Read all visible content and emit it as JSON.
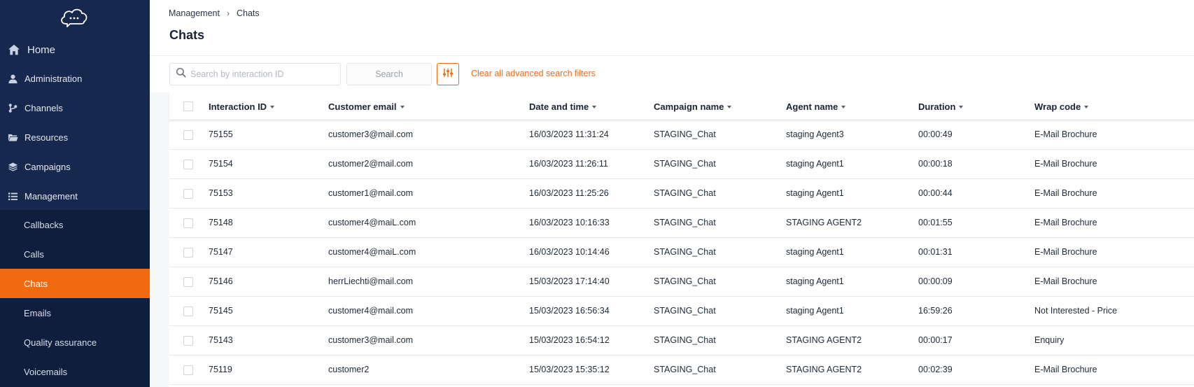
{
  "sidebar": {
    "home": "Home",
    "items": [
      {
        "label": "Administration",
        "icon": "user-icon"
      },
      {
        "label": "Channels",
        "icon": "channels-icon"
      },
      {
        "label": "Resources",
        "icon": "folder-icon"
      },
      {
        "label": "Campaigns",
        "icon": "layers-icon"
      },
      {
        "label": "Management",
        "icon": "list-icon"
      }
    ],
    "submenu": [
      {
        "label": "Callbacks",
        "active": false
      },
      {
        "label": "Calls",
        "active": false
      },
      {
        "label": "Chats",
        "active": true
      },
      {
        "label": "Emails",
        "active": false
      },
      {
        "label": "Quality assurance",
        "active": false
      },
      {
        "label": "Voicemails",
        "active": false
      }
    ]
  },
  "header": {
    "breadcrumb": [
      "Management",
      "Chats"
    ],
    "title": "Chats"
  },
  "toolbar": {
    "search_placeholder": "Search by interaction ID",
    "search_value": "",
    "search_button": "Search",
    "clear_filters": "Clear all advanced search filters"
  },
  "table": {
    "columns": [
      "Interaction ID",
      "Customer email",
      "Date and time",
      "Campaign name",
      "Agent name",
      "Duration",
      "Wrap code"
    ],
    "rows": [
      [
        "75155",
        "customer3@mail.com",
        "16/03/2023 11:31:24",
        "STAGING_Chat",
        "staging Agent3",
        "00:00:49",
        "E-Mail Brochure"
      ],
      [
        "75154",
        "customer2@mail.com",
        "16/03/2023 11:26:11",
        "STAGING_Chat",
        "staging Agent1",
        "00:00:18",
        "E-Mail Brochure"
      ],
      [
        "75153",
        "customer1@mail.com",
        "16/03/2023 11:25:26",
        "STAGING_Chat",
        "staging Agent1",
        "00:00:44",
        "E-Mail Brochure"
      ],
      [
        "75148",
        "customer4@maiL.com",
        "16/03/2023 10:16:33",
        "STAGING_Chat",
        "STAGING AGENT2",
        "00:01:55",
        "E-Mail Brochure"
      ],
      [
        "75147",
        "customer4@maiL.com",
        "16/03/2023 10:14:46",
        "STAGING_Chat",
        "staging Agent1",
        "00:01:31",
        "E-Mail Brochure"
      ],
      [
        "75146",
        "herrLiechti@mail.com",
        "15/03/2023 17:14:40",
        "STAGING_Chat",
        "staging Agent1",
        "00:00:09",
        "E-Mail Brochure"
      ],
      [
        "75145",
        "customer4@mail.com",
        "15/03/2023 16:56:34",
        "STAGING_Chat",
        "staging Agent1",
        "16:59:26",
        "Not Interested - Price"
      ],
      [
        "75143",
        "customer3@mail.com",
        "15/03/2023 16:54:12",
        "STAGING_Chat",
        "STAGING AGENT2",
        "00:00:17",
        "Enquiry"
      ],
      [
        "75119",
        "customer2",
        "15/03/2023 15:35:12",
        "STAGING_Chat",
        "STAGING AGENT2",
        "00:02:39",
        "E-Mail Brochure"
      ]
    ]
  },
  "colors": {
    "sidebar": "#16284d",
    "submenu": "#0f1e3d",
    "accent": "#f26a10"
  }
}
